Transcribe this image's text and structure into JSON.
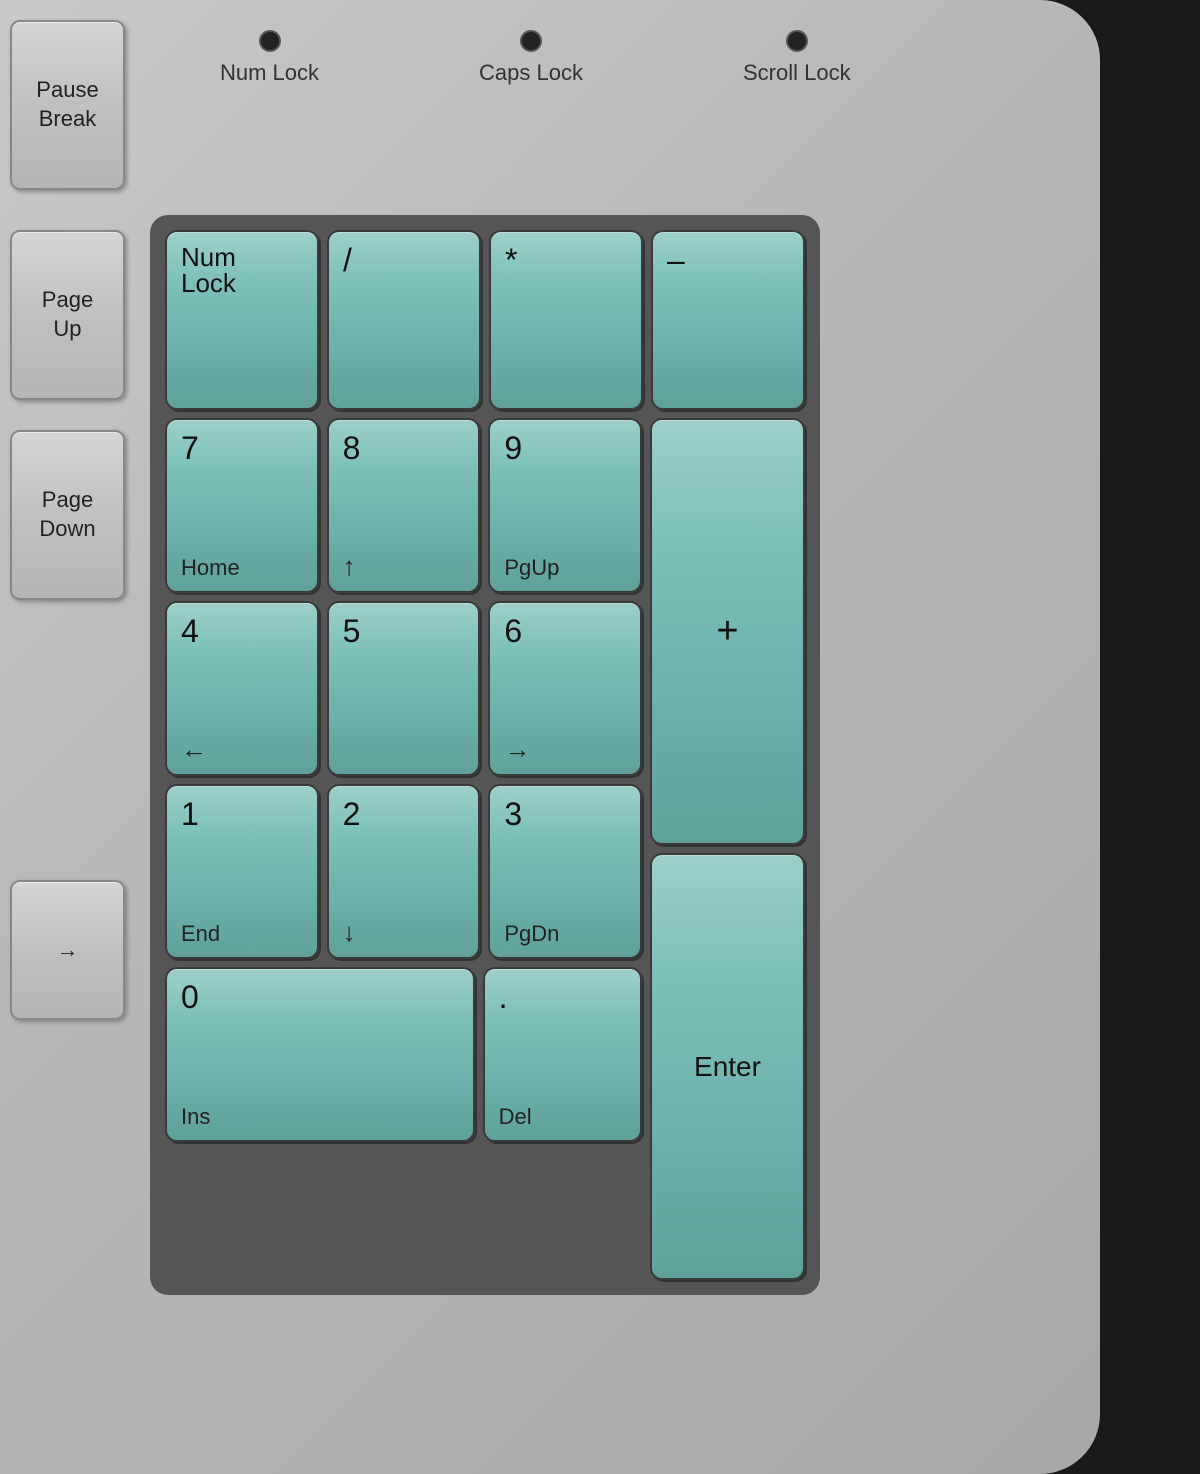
{
  "keyboard": {
    "leds": [
      {
        "id": "num-lock-led",
        "label": "Num Lock"
      },
      {
        "id": "caps-lock-led",
        "label": "Caps Lock"
      },
      {
        "id": "scroll-lock-led",
        "label": "Scroll Lock"
      }
    ],
    "side_keys": [
      {
        "id": "pause-break",
        "label": "Pause\nBreak"
      },
      {
        "id": "page-up",
        "label": "Page\nUp"
      },
      {
        "id": "page-down",
        "label": "Page\nDown"
      },
      {
        "id": "arrow-right",
        "label": "→"
      }
    ],
    "numpad": {
      "row1": [
        {
          "id": "num-lock-key",
          "main": "Num\nLock",
          "sub": ""
        },
        {
          "id": "divide-key",
          "main": "/",
          "sub": ""
        },
        {
          "id": "multiply-key",
          "main": "*",
          "sub": ""
        }
      ],
      "row2": [
        {
          "id": "key-7",
          "main": "7",
          "sub": "Home"
        },
        {
          "id": "key-8",
          "main": "8",
          "sub": "↑"
        },
        {
          "id": "key-9",
          "main": "9",
          "sub": "PgUp"
        }
      ],
      "row3": [
        {
          "id": "key-4",
          "main": "4",
          "sub": "←"
        },
        {
          "id": "key-5",
          "main": "5",
          "sub": ""
        },
        {
          "id": "key-6",
          "main": "6",
          "sub": "→"
        }
      ],
      "row4": [
        {
          "id": "key-1",
          "main": "1",
          "sub": "End"
        },
        {
          "id": "key-2",
          "main": "2",
          "sub": "↓"
        },
        {
          "id": "key-3",
          "main": "3",
          "sub": "PgDn"
        }
      ],
      "row5": [
        {
          "id": "key-0",
          "main": "0",
          "sub": "Ins"
        },
        {
          "id": "key-dot",
          "main": ".",
          "sub": "Del"
        }
      ],
      "right_col": {
        "minus": {
          "id": "minus-key",
          "main": "–"
        },
        "plus": {
          "id": "plus-key",
          "main": "+"
        },
        "enter": {
          "id": "enter-key",
          "main": "Enter"
        }
      }
    }
  }
}
